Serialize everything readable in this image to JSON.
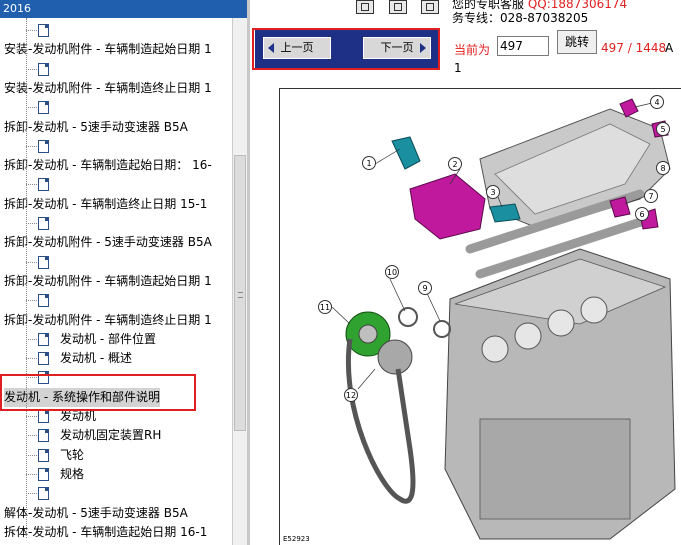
{
  "window": {
    "title_fragment": "2016"
  },
  "tree": {
    "items": [
      {
        "label": "",
        "type": "doc"
      },
      {
        "label": "安装-发动机附件 - 车辆制造起始日期 1",
        "type": "folder"
      },
      {
        "label": "",
        "type": "doc"
      },
      {
        "label": "安装-发动机附件 - 车辆制造终止日期 1",
        "type": "folder"
      },
      {
        "label": "",
        "type": "doc"
      },
      {
        "label": "拆卸-发动机 - 5速手动变速器 B5A",
        "type": "folder"
      },
      {
        "label": "",
        "type": "doc"
      },
      {
        "label": "拆卸-发动机 - 车辆制造起始日期： 16-",
        "type": "folder"
      },
      {
        "label": "",
        "type": "doc"
      },
      {
        "label": "拆卸-发动机 - 车辆制造终止日期 15-1",
        "type": "folder"
      },
      {
        "label": "",
        "type": "doc"
      },
      {
        "label": "拆卸-发动机附件 - 5速手动变速器 B5A",
        "type": "folder"
      },
      {
        "label": "",
        "type": "doc"
      },
      {
        "label": "拆卸-发动机附件 - 车辆制造起始日期 1",
        "type": "folder"
      },
      {
        "label": "",
        "type": "doc"
      },
      {
        "label": "拆卸-发动机附件 - 车辆制造终止日期 1",
        "type": "folder"
      },
      {
        "label": "发动机 - 部件位置",
        "type": "doc"
      },
      {
        "label": "发动机 - 概述",
        "type": "doc"
      },
      {
        "label": "",
        "type": "doc"
      },
      {
        "label": "发动机 - 系统操作和部件说明",
        "type": "folder",
        "selected": true
      },
      {
        "label": "发动机",
        "type": "doc"
      },
      {
        "label": "发动机固定装置RH",
        "type": "doc"
      },
      {
        "label": "飞轮",
        "type": "doc"
      },
      {
        "label": "规格",
        "type": "doc"
      },
      {
        "label": "",
        "type": "doc"
      },
      {
        "label": "解体-发动机 - 5速手动变速器 B5A",
        "type": "folder"
      },
      {
        "label": "拆体-发动机 - 车辆制造起始日期 16-1",
        "type": "folder"
      }
    ]
  },
  "nav": {
    "prev_label": "上一页",
    "next_label": "下一页"
  },
  "contact": {
    "line1_prefix": "您的专职客服",
    "qq": "QQ:1887306174",
    "line2": "务专线：028-87038205"
  },
  "pager": {
    "current_label": "当前为",
    "current_page": "497",
    "jump_label": "跳转",
    "count": "497 / 1448",
    "suffix": "A",
    "sub": "1"
  },
  "diagram": {
    "code": "E52923",
    "callouts": [
      "1",
      "2",
      "3",
      "4",
      "5",
      "6",
      "7",
      "8",
      "9",
      "10",
      "11",
      "12"
    ]
  },
  "colors": {
    "nav_bg": "#1e2f86",
    "highlight_red": "#e02020",
    "titlebar": "#1f5fae"
  }
}
